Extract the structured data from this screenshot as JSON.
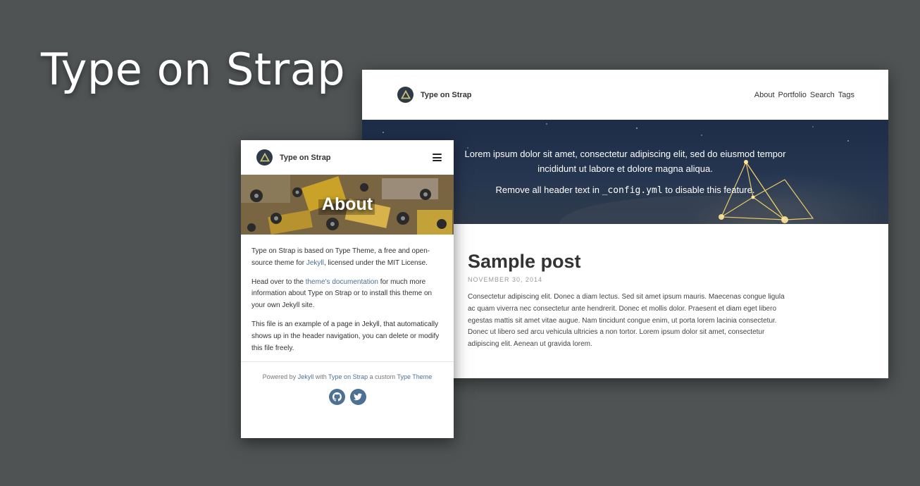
{
  "title": "Type on Strap",
  "desktop": {
    "brand": "Type on Strap",
    "menu": [
      "About",
      "Portfolio",
      "Search",
      "Tags"
    ],
    "banner": {
      "line1": "Lorem ipsum dolor sit amet, consectetur adipiscing elit, sed do eiusmod tempor incididunt ut labore et dolore magna aliqua.",
      "line2_prefix": "Remove all header text in ",
      "line2_code": "_config.yml",
      "line2_suffix": " to disable this feature."
    },
    "post": {
      "title": "Sample post",
      "date": "NOVEMBER 30, 2014",
      "body": "Consectetur adipiscing elit. Donec a diam lectus. Sed sit amet ipsum mauris. Maecenas congue ligula ac quam viverra nec consectetur ante hendrerit. Donec et mollis dolor. Praesent et diam eget libero egestas mattis sit amet vitae augue. Nam tincidunt congue enim, ut porta lorem lacinia consectetur. Donec ut libero sed arcu vehicula ultricies a non tortor. Lorem ipsum dolor sit amet, consectetur adipiscing elit. Aenean ut gravida lorem."
    }
  },
  "mobile": {
    "brand": "Type on Strap",
    "banner_title": "About",
    "p1": {
      "a": "Type on Strap is based on Type Theme, a free and open-source theme for ",
      "link": "Jekyll",
      "b": ", licensed under the MIT License."
    },
    "p2": {
      "a": "Head over to the ",
      "link": "theme’s documentation",
      "b": " for much more information about Type on Strap or to install this theme on your own Jekyll site."
    },
    "p3": "This file is an example of a page in Jekyll, that automatically shows up in the header navigation, you can delete or modify this file freely.",
    "footer": {
      "powered": "Powered by ",
      "link1": "Jekyll",
      "with": " with ",
      "link2": "Type on Strap",
      "custom": " a custom ",
      "link3": "Type Theme"
    },
    "social": [
      "github-icon",
      "twitter-icon"
    ]
  },
  "colors": {
    "background": "#4f5354",
    "link": "#4d7192",
    "logo": "#2e3b47",
    "logo_triangle": "#c8c27a"
  }
}
